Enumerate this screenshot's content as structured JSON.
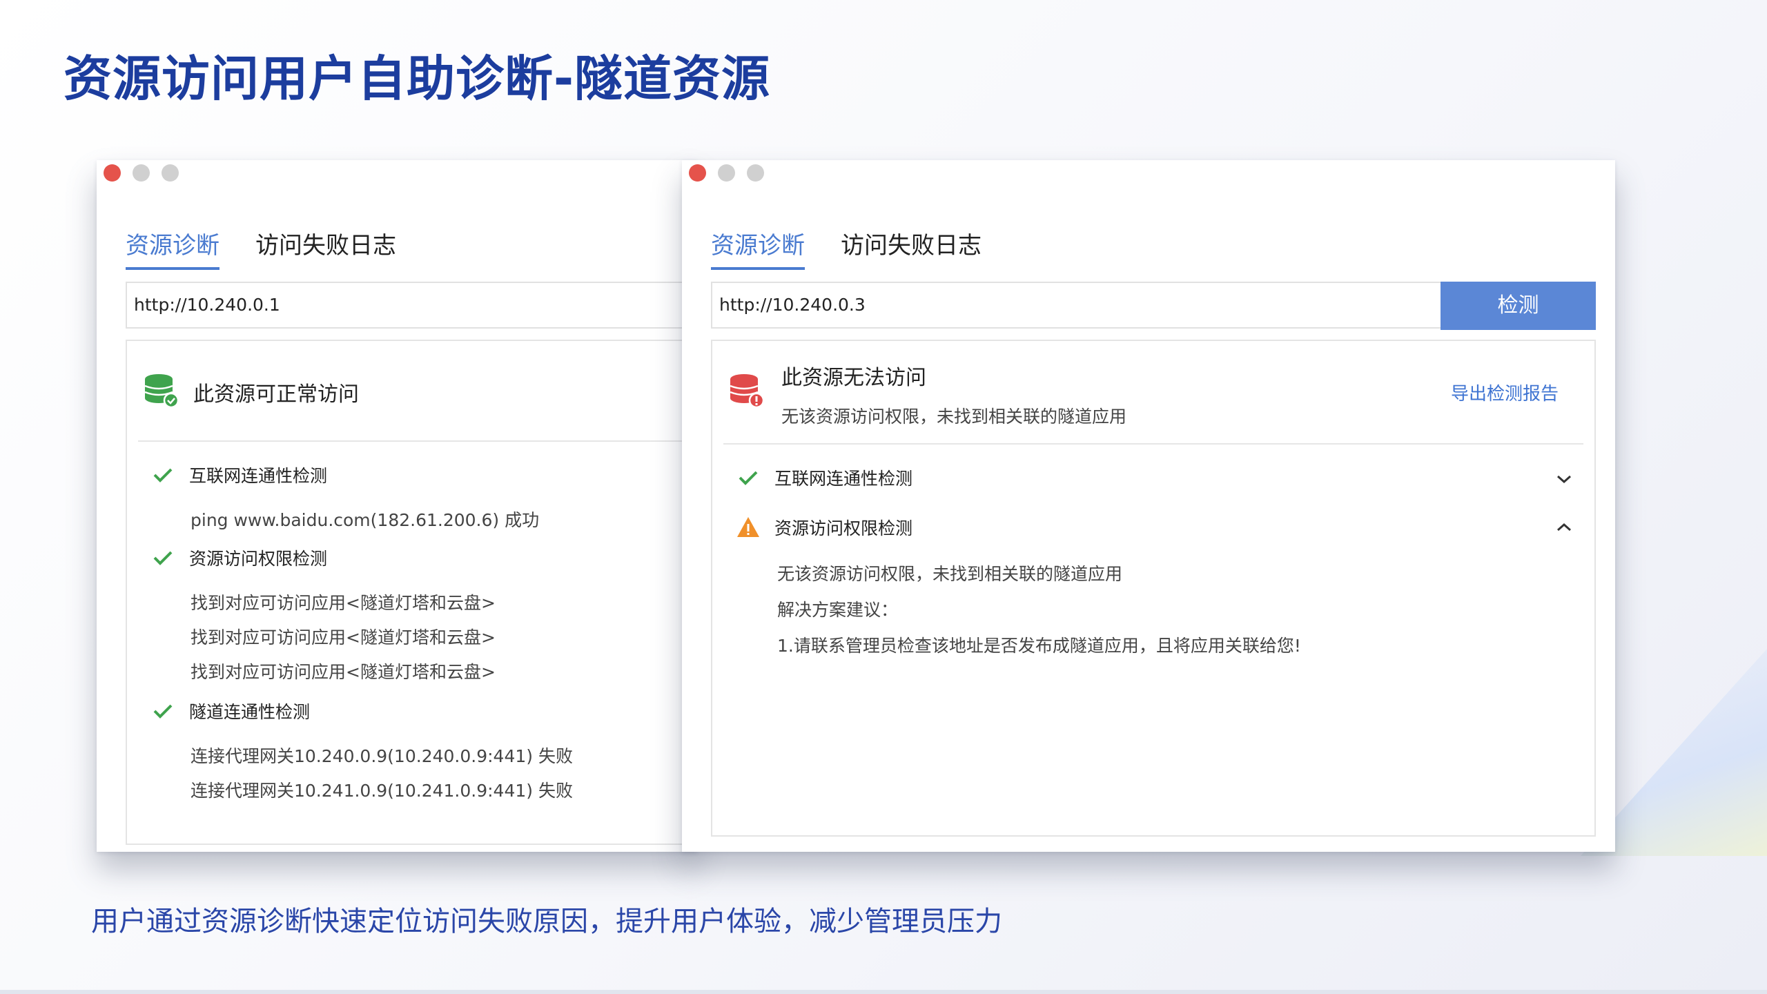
{
  "slide": {
    "title": "资源访问用户自助诊断-隧道资源",
    "footer": "用户通过资源诊断快速定位访问失败原因，提升用户体验，减少管理员压力"
  },
  "left_window": {
    "tabs": [
      "资源诊断",
      "访问失败日志"
    ],
    "url": "http://10.240.0.1",
    "status": "此资源可正常访问",
    "checks": [
      {
        "title": "互联网连通性检测",
        "details": [
          "ping www.baidu.com(182.61.200.6) 成功"
        ]
      },
      {
        "title": "资源访问权限检测",
        "details": [
          "找到对应可访问应用<隧道灯塔和云盘>",
          "找到对应可访问应用<隧道灯塔和云盘>",
          "找到对应可访问应用<隧道灯塔和云盘>"
        ]
      },
      {
        "title": "隧道连通性检测",
        "details": [
          "连接代理网关10.240.0.9(10.240.0.9:441) 失败",
          "连接代理网关10.241.0.9(10.241.0.9:441) 失败"
        ]
      }
    ]
  },
  "right_window": {
    "tabs": [
      "资源诊断",
      "访问失败日志"
    ],
    "url": "http://10.240.0.3",
    "detect_button": "检测",
    "status": "此资源无法访问",
    "status_detail": "无该资源访问权限，未找到相关联的隧道应用",
    "export_link": "导出检测报告",
    "checks": [
      {
        "title": "互联网连通性检测",
        "state": "ok",
        "expanded": false
      },
      {
        "title": "资源访问权限检测",
        "state": "warning",
        "expanded": true,
        "details": [
          "无该资源访问权限，未找到相关联的隧道应用",
          "解决方案建议：",
          "1.请联系管理员检查该地址是否发布成隧道应用，且将应用关联给您!"
        ]
      }
    ]
  },
  "colors": {
    "title_blue": "#1c3d9e",
    "accent_blue": "#4a7bd0",
    "button_blue": "#5b87d6",
    "check_green": "#3fa34d",
    "warning_orange": "#f0902a",
    "error_red": "#e04a4a"
  },
  "icons": [
    "database-ok-icon",
    "database-error-icon",
    "check-icon",
    "warning-icon",
    "chevron-down-icon",
    "chevron-up-icon"
  ]
}
